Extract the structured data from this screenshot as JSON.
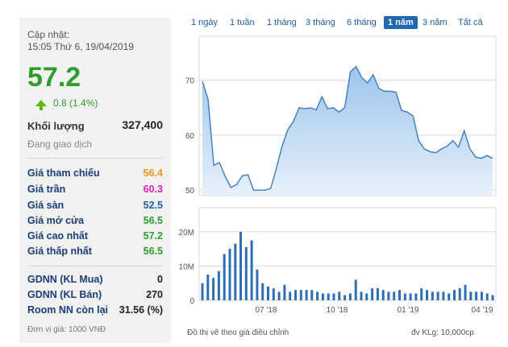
{
  "update": {
    "label": "Cập nhật:",
    "time": "15:05 Thứ 6, 19/04/2019"
  },
  "price": "57.2",
  "change": "0.8 (1.4%)",
  "volume": {
    "label": "Khối lượng",
    "value": "327,400"
  },
  "status": "Đang giao dịch",
  "price_rows": [
    {
      "label": "Giá tham chiếu",
      "value": "56.4",
      "color": "#f7941d"
    },
    {
      "label": "Giá trần",
      "value": "60.3",
      "color": "#e020c0"
    },
    {
      "label": "Giá sàn",
      "value": "52.5",
      "color": "#1f5fa8"
    },
    {
      "label": "Giá mở cửa",
      "value": "56.5",
      "color": "#2e9d2e"
    },
    {
      "label": "Giá cao nhất",
      "value": "57.2",
      "color": "#2e9d2e"
    },
    {
      "label": "Giá thấp nhất",
      "value": "56.5",
      "color": "#2e9d2e"
    }
  ],
  "foreign_rows": [
    {
      "label": "GDNN (KL Mua)",
      "value": "0"
    },
    {
      "label": "GDNN (KL Bán)",
      "value": "270"
    },
    {
      "label": "Room NN còn lại",
      "value": "31.56 (%)"
    }
  ],
  "unit_note": "Đơn vị giá: 1000 VNĐ",
  "tabs": [
    {
      "label": "1 ngày",
      "active": false
    },
    {
      "label": "1 tuần",
      "active": false
    },
    {
      "label": "1 tháng",
      "active": false
    },
    {
      "label": "3 tháng",
      "active": false
    },
    {
      "label": "6 tháng",
      "active": false
    },
    {
      "label": "1 năm",
      "active": true
    },
    {
      "label": "3 năm",
      "active": false
    },
    {
      "label": "Tất cả",
      "active": false
    }
  ],
  "footer": {
    "left": "Đồ thị vẽ theo giá điều chỉnh",
    "right": "đv KLg: 10,000cp"
  },
  "chart_data": {
    "type": "area",
    "price": {
      "y_ticks": [
        "70",
        "60",
        "50"
      ],
      "ylim": [
        49,
        78
      ],
      "values": [
        69.8,
        66.5,
        54.5,
        55.0,
        52.5,
        50.5,
        51.0,
        52.6,
        52.8,
        50.0,
        50.0,
        50.0,
        50.3,
        54.0,
        58.0,
        61.0,
        62.5,
        65.0,
        64.8,
        65.0,
        64.6,
        67.0,
        64.8,
        65.0,
        64.2,
        65.0,
        71.5,
        72.5,
        70.5,
        69.5,
        71.0,
        68.5,
        68.0,
        68.0,
        67.8,
        64.5,
        64.2,
        63.5,
        59.0,
        57.5,
        57.0,
        56.8,
        57.5,
        58.0,
        59.0,
        57.8,
        60.8,
        57.5,
        56.0,
        55.8,
        56.3,
        55.8
      ]
    },
    "volume": {
      "y_ticks": [
        "20M",
        "10M",
        "0"
      ],
      "ylim": [
        0,
        27
      ],
      "values": [
        5,
        7.5,
        6.5,
        8.5,
        13.5,
        15,
        16.5,
        20,
        15.5,
        17.5,
        9,
        5,
        4,
        3.5,
        2.5,
        4.5,
        2.5,
        3,
        3,
        3,
        3,
        2.5,
        2,
        2,
        2,
        2.5,
        1.5,
        2,
        6,
        2.5,
        2,
        3.5,
        3.5,
        3,
        2.5,
        2.5,
        3,
        2,
        2,
        2,
        3.5,
        3,
        2.5,
        2.5,
        2.5,
        2,
        3,
        3.5,
        4.5,
        2.5,
        2.5,
        2.5,
        2,
        1.5
      ]
    },
    "x_ticks": [
      "07 '18",
      "10 '18",
      "01 '19",
      "04 '19"
    ],
    "colors": {
      "line": "#3d7cc9",
      "fill_top": "#9cc4ec",
      "fill_bottom": "#e8f1fb",
      "bar": "#2f6db5",
      "grid": "#d9d9d9"
    }
  }
}
